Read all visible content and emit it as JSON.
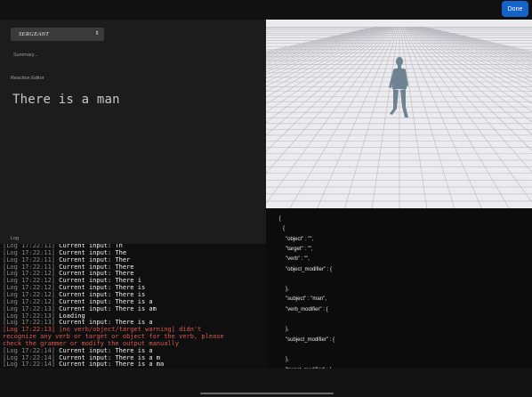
{
  "topbar": {
    "done_label": "Done"
  },
  "controls": {
    "rank_select": "SERGEANT",
    "summary_placeholder": "Summary..."
  },
  "reaction_editor": {
    "label": "Reaction Editor",
    "text": "There is a man"
  },
  "log": {
    "label": "Log",
    "lines": [
      {
        "ts": "[Log 17:22:11]",
        "msg": " Current input: Th"
      },
      {
        "ts": "[Log 17:22:11]",
        "msg": " Current input: The"
      },
      {
        "ts": "[Log 17:22:11]",
        "msg": " Current input: Ther"
      },
      {
        "ts": "[Log 17:22:11]",
        "msg": " Current input: There"
      },
      {
        "ts": "[Log 17:22:12]",
        "msg": " Current input: There"
      },
      {
        "ts": "[Log 17:22:12]",
        "msg": " Current input: There i"
      },
      {
        "ts": "[Log 17:22:12]",
        "msg": " Current input: There is"
      },
      {
        "ts": "[Log 17:22:12]",
        "msg": " Current input: There is"
      },
      {
        "ts": "[Log 17:22:12]",
        "msg": " Current input: There is a"
      },
      {
        "ts": "[Log 17:22:13]",
        "msg": " Current input: There is am"
      },
      {
        "ts": "[Log 17:22:13]",
        "msg": " Loading"
      },
      {
        "ts": "[Log 17:22:13]",
        "msg": " Current input: There is a"
      },
      {
        "warn": "[Log 17:22:13] [no verb/object/target warning] didn't"
      },
      {
        "warn": "recognize any verb or target or object for the verb, please"
      },
      {
        "warn": "check the grammer or modify the output manually"
      },
      {
        "ts": "[Log 17:22:14]",
        "msg": " Current input: There is a"
      },
      {
        "ts": "[Log 17:22:14]",
        "msg": " Current input: There is a m"
      },
      {
        "ts": "[Log 17:22:14]",
        "msg": " Current input: There is a ma"
      }
    ]
  },
  "json_output": {
    "lines": [
      "[",
      "{",
      "\"object\" : \"\",",
      "\"target\" : \"\",",
      "\"verb\" : \"\",",
      "\"object_modifier\" : {",
      "",
      "},",
      "\"subject\" : \"man\",",
      "\"verb_modifier\" : {",
      "",
      "},",
      "\"subject_modifier\" : {",
      "",
      "},",
      "\"target_modifier\" : {"
    ]
  },
  "colors": {
    "accent": "#1463c8",
    "warning": "#d9584f",
    "viewport_bg": "#e9e9ec"
  },
  "icons": {
    "select_chevron": "up-down-chevron-icon",
    "character": "humanoid-figure-icon"
  }
}
